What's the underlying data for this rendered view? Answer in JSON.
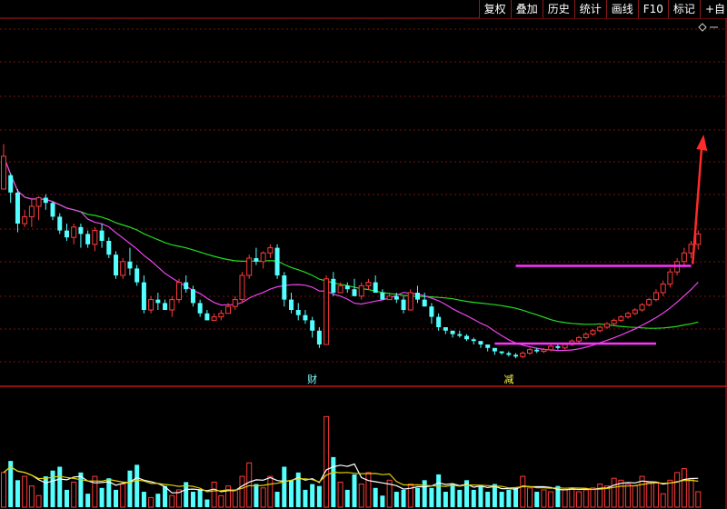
{
  "toolbar": {
    "buttons": [
      "复权",
      "叠加",
      "历史",
      "统计",
      "画线",
      "F10",
      "标记",
      "+自"
    ]
  },
  "colors": {
    "background": "#000000",
    "grid": "#7a1010",
    "up": "#ff3b3b",
    "down": "#54ffff",
    "ma_long": "#22dd22",
    "ma_mid": "#ee44ee",
    "vol_ma_short": "#ffffff",
    "vol_ma_long": "#e0d000",
    "annotation": "#ff33ff",
    "arrow": "#ff2a2a"
  },
  "chart_data": {
    "type": "candlestick",
    "price_grid": "on",
    "annotations": {
      "upper_line": {
        "from_index": 73,
        "to_index": 98,
        "price": 55.5
      },
      "lower_line": {
        "from_index": 70,
        "to_index": 93,
        "price": 10.5
      },
      "arrow": {
        "at_index": 99,
        "from_price": 56.5,
        "to_price": 130.5
      },
      "event_labels": [
        {
          "text": "财",
          "index": 44,
          "color": "#80ffff"
        },
        {
          "text": "减",
          "index": 72,
          "color": "#ffff44"
        }
      ],
      "diamond_icon": "diamond-outline"
    },
    "candles": [
      [
        100,
        119,
        101,
        126,
        98
      ],
      [
        108,
        98,
        92,
        109,
        91
      ],
      [
        98,
        80,
        75,
        100,
        74
      ],
      [
        80,
        84,
        78,
        88,
        75
      ],
      [
        84,
        90,
        78,
        94,
        76
      ],
      [
        90,
        95,
        82,
        96,
        80
      ],
      [
        95,
        92,
        88,
        97,
        86
      ],
      [
        92,
        84,
        82,
        93,
        80
      ],
      [
        84,
        76,
        74,
        86,
        72
      ],
      [
        76,
        72,
        70,
        80,
        68
      ],
      [
        72,
        78,
        68,
        80,
        65
      ],
      [
        78,
        74,
        66,
        80,
        64
      ],
      [
        74,
        68,
        66,
        76,
        64
      ],
      [
        68,
        76,
        64,
        78,
        62
      ],
      [
        76,
        70,
        66,
        80,
        64
      ],
      [
        70,
        62,
        60,
        72,
        56
      ],
      [
        62,
        50,
        48,
        64,
        46
      ],
      [
        50,
        58,
        48,
        60,
        46
      ],
      [
        58,
        54,
        50,
        66,
        48
      ],
      [
        54,
        46,
        44,
        56,
        40
      ],
      [
        46,
        30,
        28,
        50,
        26
      ],
      [
        30,
        36,
        28,
        38,
        26
      ],
      [
        36,
        34,
        30,
        40,
        30
      ],
      [
        34,
        30,
        30,
        36,
        28
      ],
      [
        30,
        36,
        26,
        38,
        26
      ],
      [
        36,
        46,
        34,
        48,
        32
      ],
      [
        46,
        42,
        40,
        50,
        38
      ],
      [
        42,
        34,
        32,
        44,
        32
      ],
      [
        34,
        28,
        26,
        36,
        24
      ],
      [
        28,
        24,
        24,
        30,
        22
      ],
      [
        24,
        26,
        24,
        28,
        20
      ],
      [
        26,
        28,
        24,
        30,
        24
      ],
      [
        28,
        32,
        28,
        34,
        26
      ],
      [
        32,
        36,
        30,
        38,
        30
      ],
      [
        36,
        50,
        34,
        52,
        32
      ],
      [
        50,
        60,
        48,
        62,
        46
      ],
      [
        60,
        58,
        56,
        66,
        54
      ],
      [
        58,
        63,
        54,
        64,
        52
      ],
      [
        63,
        66,
        60,
        68,
        58
      ],
      [
        66,
        50,
        48,
        68,
        44
      ],
      [
        50,
        36,
        32,
        52,
        30
      ],
      [
        36,
        30,
        28,
        40,
        24
      ],
      [
        30,
        27,
        24,
        34,
        22
      ],
      [
        27,
        24,
        22,
        30,
        20
      ],
      [
        24,
        18,
        14,
        26,
        12
      ],
      [
        18,
        10,
        8,
        20,
        6
      ],
      [
        10,
        48,
        46,
        50,
        2
      ],
      [
        48,
        40,
        38,
        52,
        36
      ],
      [
        40,
        44,
        40,
        46,
        36
      ],
      [
        44,
        42,
        40,
        46,
        40
      ],
      [
        42,
        38,
        38,
        48,
        36
      ],
      [
        38,
        44,
        36,
        46,
        36
      ],
      [
        44,
        46,
        42,
        48,
        38
      ],
      [
        46,
        40,
        40,
        50,
        38
      ],
      [
        40,
        36,
        36,
        42,
        36
      ],
      [
        36,
        38,
        36,
        40,
        34
      ],
      [
        38,
        36,
        34,
        40,
        30
      ],
      [
        36,
        30,
        28,
        38,
        28
      ],
      [
        30,
        40,
        30,
        42,
        28
      ],
      [
        40,
        36,
        34,
        44,
        32
      ],
      [
        36,
        32,
        32,
        40,
        30
      ],
      [
        32,
        26,
        22,
        34,
        20
      ],
      [
        26,
        20,
        18,
        28,
        14
      ],
      [
        20,
        18,
        16,
        20,
        16
      ],
      [
        18,
        16,
        14,
        18,
        12
      ],
      [
        16,
        15,
        14,
        18,
        12
      ],
      [
        15,
        13,
        12,
        16,
        10
      ],
      [
        13,
        12,
        10,
        14,
        8
      ],
      [
        12,
        10,
        8,
        12,
        6
      ],
      [
        10,
        8,
        6,
        10,
        4
      ],
      [
        8,
        6,
        4,
        8,
        2
      ],
      [
        6,
        5,
        4,
        6,
        3
      ],
      [
        5,
        4,
        3,
        6,
        2
      ],
      [
        4,
        3,
        2,
        5,
        1
      ],
      [
        3,
        5,
        2,
        6,
        1
      ],
      [
        5,
        7,
        4,
        8,
        3
      ],
      [
        7,
        6,
        5,
        8,
        4
      ],
      [
        6,
        7,
        5,
        8,
        4
      ],
      [
        7,
        9,
        6,
        10,
        5
      ],
      [
        9,
        8,
        7,
        10,
        6
      ],
      [
        8,
        10,
        7,
        11,
        6
      ],
      [
        10,
        12,
        9,
        13,
        8
      ],
      [
        12,
        14,
        11,
        15,
        10
      ],
      [
        14,
        16,
        13,
        17,
        12
      ],
      [
        16,
        18,
        15,
        19,
        14
      ],
      [
        18,
        20,
        17,
        21,
        16
      ],
      [
        20,
        22,
        19,
        23,
        18
      ],
      [
        22,
        24,
        21,
        25,
        20
      ],
      [
        24,
        26,
        23,
        27,
        22
      ],
      [
        26,
        28,
        25,
        29,
        24
      ],
      [
        28,
        30,
        27,
        31,
        26
      ],
      [
        30,
        33,
        29,
        34,
        28
      ],
      [
        33,
        36,
        32,
        37,
        31
      ],
      [
        36,
        40,
        35,
        42,
        34
      ],
      [
        40,
        45,
        38,
        47,
        36
      ],
      [
        45,
        52,
        43,
        54,
        41
      ],
      [
        52,
        58,
        50,
        60,
        48
      ],
      [
        58,
        63,
        55,
        66,
        53
      ],
      [
        63,
        68,
        60,
        70,
        57
      ],
      [
        68,
        74,
        65,
        76,
        62
      ]
    ],
    "volume": [
      18,
      24,
      14,
      16,
      11,
      6,
      16,
      19,
      21,
      9,
      13,
      18,
      7,
      16,
      10,
      15,
      9,
      12,
      19,
      22,
      8,
      5,
      7,
      11,
      6,
      9,
      13,
      8,
      9,
      4,
      13,
      6,
      11,
      9,
      16,
      23,
      12,
      10,
      16,
      8,
      21,
      14,
      18,
      9,
      12,
      11,
      47,
      26,
      13,
      9,
      17,
      12,
      18,
      10,
      6,
      14,
      8,
      9,
      12,
      10,
      14,
      10,
      17,
      8,
      12,
      9,
      14,
      9,
      11,
      8,
      12,
      8,
      9,
      10,
      16,
      10,
      8,
      9,
      8,
      11,
      9,
      10,
      8,
      9,
      10,
      12,
      11,
      15,
      14,
      12,
      11,
      16,
      13,
      13,
      7,
      14,
      18,
      20,
      15,
      8
    ]
  }
}
